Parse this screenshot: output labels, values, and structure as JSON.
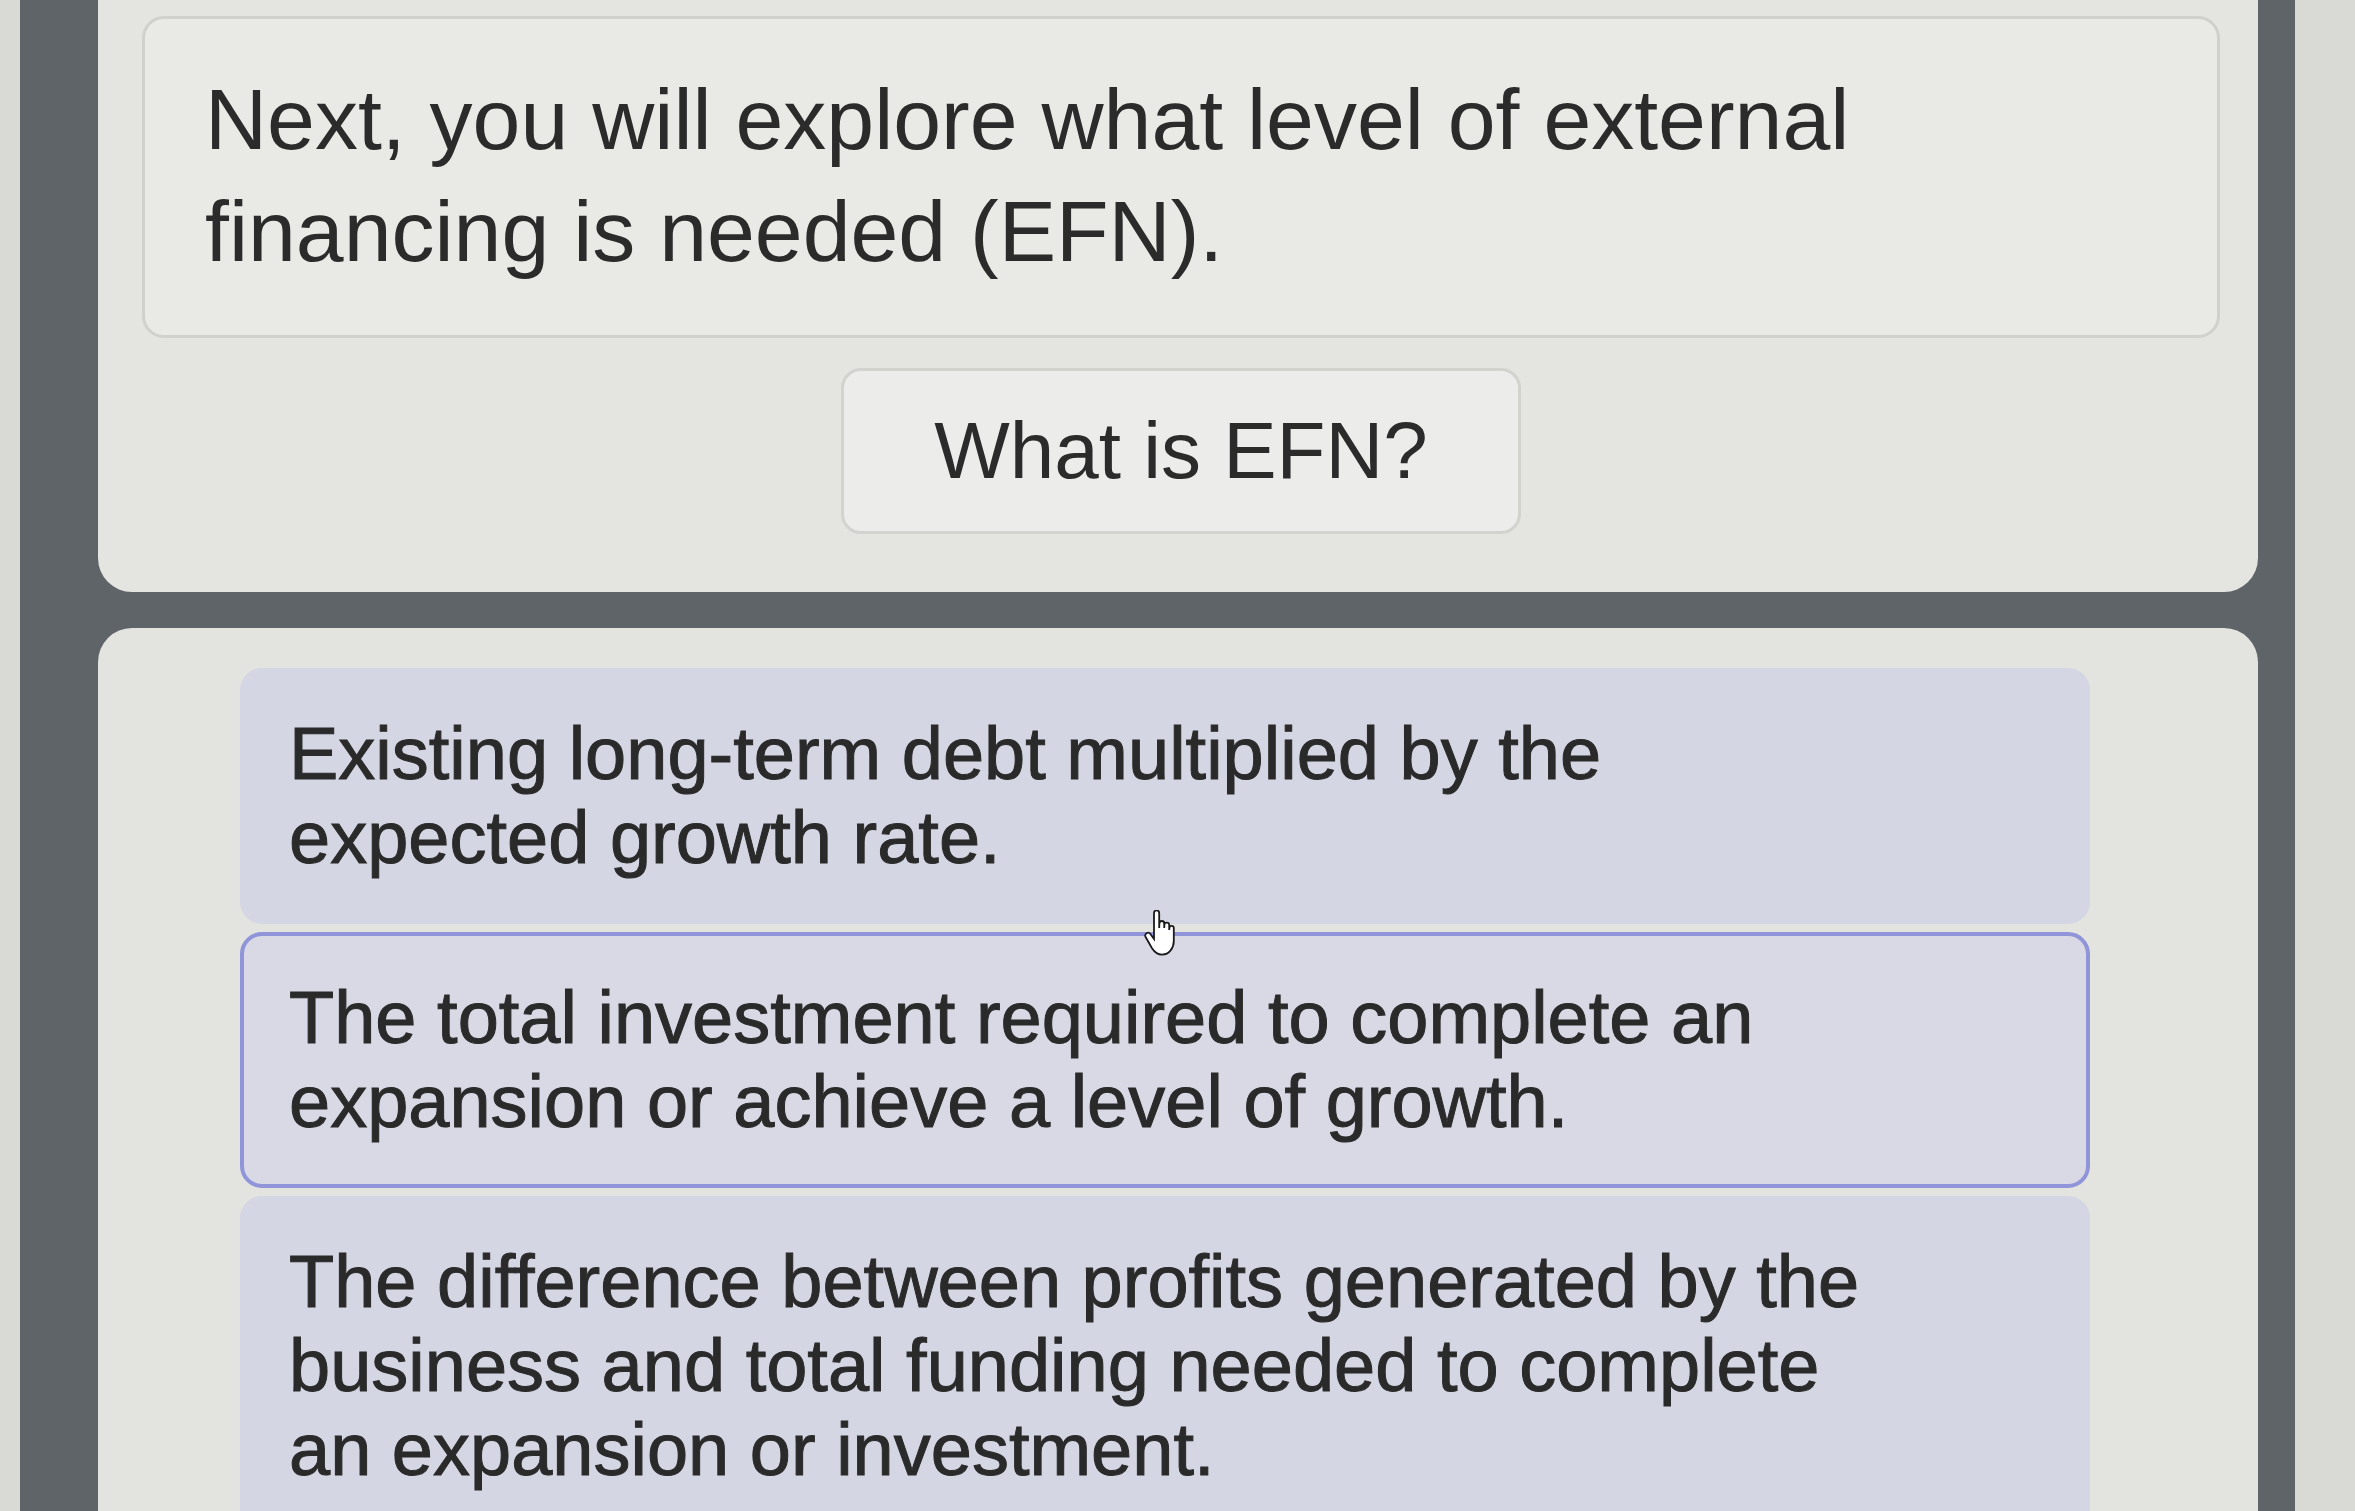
{
  "intro": {
    "text": "Next, you will explore what level of external financing is needed (EFN)."
  },
  "question": {
    "text": "What is EFN?"
  },
  "options": [
    {
      "text": "Existing long-term debt multiplied by the expected growth rate.",
      "highlighted": false
    },
    {
      "text": "The total investment required to complete an expansion or achieve a level of growth.",
      "highlighted": true
    },
    {
      "text": "The difference between profits generated by the business and total funding needed to complete an expansion or investment.",
      "highlighted": false
    }
  ]
}
